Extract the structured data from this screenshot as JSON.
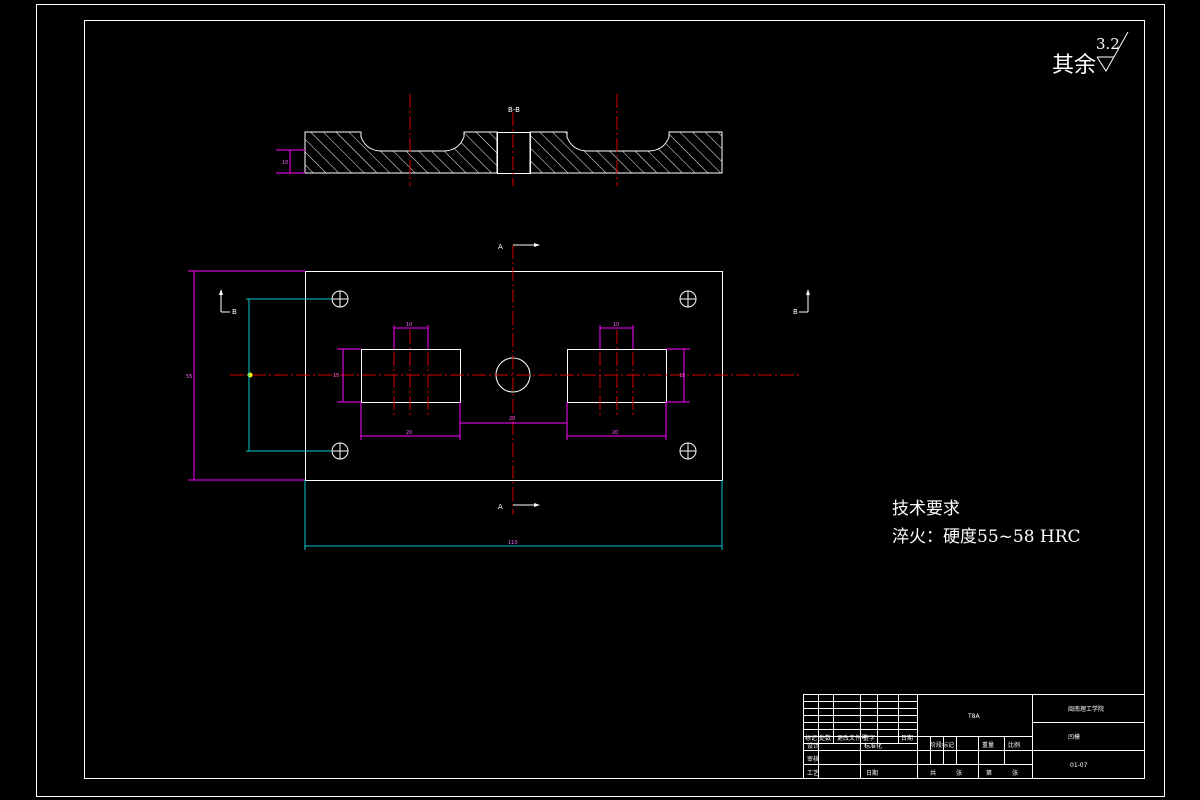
{
  "roughness": {
    "prefix": "其余",
    "value": "3.2"
  },
  "section_view": {
    "label": "B-B"
  },
  "cut_markers": {
    "a_top": "A",
    "a_bottom": "A",
    "b_left": "B",
    "b_right": "B"
  },
  "dimensions": {
    "slot_width_left": "10",
    "slot_width_right": "10",
    "slot_length_left": "20",
    "slot_length_right": "20",
    "center_spacing": "20",
    "overall_length": "110",
    "overall_height": "55",
    "slot_height_left": "15",
    "slot_height_right": "15",
    "section_thickness": "10"
  },
  "tech_requirements": {
    "title": "技术要求",
    "line1": "淬火：硬度55~58 HRC"
  },
  "title_block": {
    "material": "T8A",
    "school": "闽南理工学院",
    "part_name": "凹模",
    "drawing_no": "01-07",
    "r_biaoji": "标记",
    "r_chushu": "处数",
    "r_wenjian": "更改文件号",
    "r_qianzi": "签字",
    "r_riqi": "日期",
    "r_sheji": "设计",
    "r_biaozhun": "标准化",
    "r_shenhe": "审核",
    "r_gongyi": "工艺",
    "r_pizhun": "日期",
    "r_jieduan": "阶段标记",
    "r_zhongliang": "重量",
    "r_bili": "比例",
    "r_gong": "共",
    "r_zhang1": "张",
    "r_di": "第",
    "r_zhang2": "张"
  }
}
